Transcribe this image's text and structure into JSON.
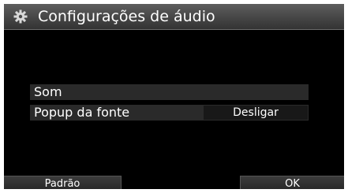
{
  "header": {
    "icon": "gear-icon",
    "title": "Configurações de áudio"
  },
  "menu": {
    "items": [
      {
        "label": "Som",
        "value": ""
      },
      {
        "label": "Popup da fonte",
        "value": "Desligar"
      }
    ]
  },
  "footer": {
    "default_label": "Padrão",
    "ok_label": "OK"
  },
  "colors": {
    "background": "#000000",
    "text": "#ffffff",
    "header": "#4a4a4a",
    "row": "#2a2a2a"
  }
}
